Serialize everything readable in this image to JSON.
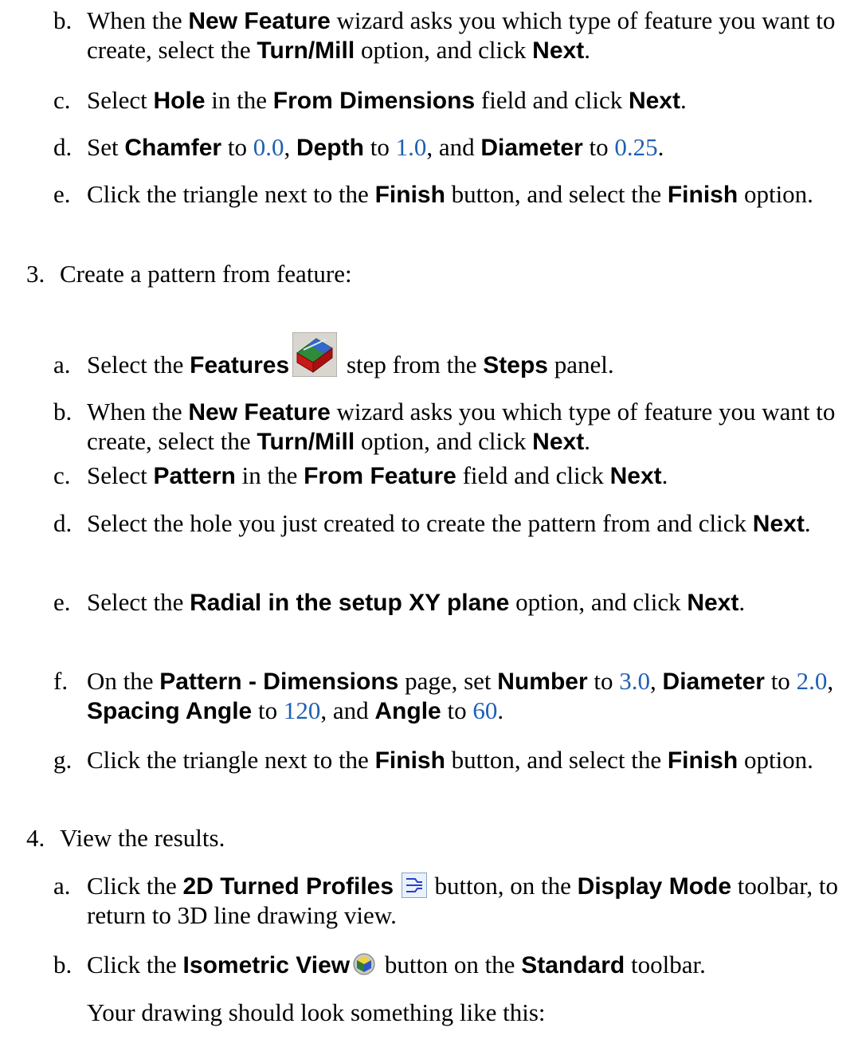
{
  "step2": {
    "b": {
      "letter": "b.",
      "t1": "When the ",
      "b1": "New Feature",
      "t2": " wizard asks you which type of feature you want to create, select the ",
      "b2": "Turn/Mill",
      "t3": " option, and click ",
      "b3": "Next",
      "t4": "."
    },
    "c": {
      "letter": "c.",
      "t1": "Select ",
      "b1": "Hole",
      "t2": " in the ",
      "b2": "From Dimensions",
      "t3": " field and click ",
      "b3": "Next",
      "t4": "."
    },
    "d": {
      "letter": "d.",
      "t1": "Set ",
      "b1": "Chamfer",
      "t2": " to ",
      "v1": "0.0",
      "t3": ", ",
      "b2": "Depth",
      "t4": " to ",
      "v2": "1.0",
      "t5": ", and ",
      "b3": "Diameter",
      "t6": " to ",
      "v3": "0.25",
      "t7": "."
    },
    "e": {
      "letter": "e.",
      "t1": "Click the triangle next to the ",
      "b1": "Finish",
      "t2": " button, and select the ",
      "b2": "Finish",
      "t3": " option."
    }
  },
  "step3": {
    "num": "3.",
    "title": "Create a pattern from feature:",
    "a": {
      "letter": "a.",
      "t1": "Select the ",
      "b1": "Features",
      "t2": " step from the ",
      "b2": "Steps",
      "t3": " panel.",
      "icon": "features-step-icon"
    },
    "b": {
      "letter": "b.",
      "t1": "When the ",
      "b1": "New Feature",
      "t2": " wizard asks you which type of feature you want to create, select the ",
      "b2": "Turn/Mill",
      "t3": " option, and click ",
      "b3": "Next",
      "t4": "."
    },
    "c": {
      "letter": "c.",
      "t1": "Select ",
      "b1": "Pattern",
      "t2": " in the ",
      "b2": "From Feature",
      "t3": " field and click ",
      "b3": "Next",
      "t4": "."
    },
    "d": {
      "letter": "d.",
      "t1": "Select the hole you just created to create the pattern from and click ",
      "b1": "Next",
      "t2": "."
    },
    "e": {
      "letter": "e.",
      "t1": "Select the ",
      "b1": "Radial in the setup XY plane",
      "t2": " option, and click ",
      "b2": "Next",
      "t3": "."
    },
    "f": {
      "letter": "f.",
      "t1": "On the ",
      "b1": "Pattern - Dimensions",
      "t2": " page, set ",
      "b2": "Number",
      "t3": " to ",
      "v1": "3.0",
      "t4": ", ",
      "b3": "Diameter",
      "t5": " to ",
      "v2": "2.0",
      "t6": ", ",
      "b4": "Spacing Angle",
      "t7": " to ",
      "v3": "120",
      "t8": ", and ",
      "b5": "Angle",
      "t9": " to ",
      "v4": "60",
      "t10": "."
    },
    "g": {
      "letter": "g.",
      "t1": "Click the triangle next to the ",
      "b1": "Finish",
      "t2": " button, and select the ",
      "b2": "Finish",
      "t3": " option."
    }
  },
  "step4": {
    "num": "4.",
    "title": "View the results.",
    "a": {
      "letter": "a.",
      "t1": "Click the ",
      "b1": "2D Turned Profiles",
      "t2": " button, on the ",
      "b2": "Display Mode",
      "t3": " toolbar, to return to 3D line drawing view.",
      "icon": "turned-profiles-icon"
    },
    "b": {
      "letter": "b.",
      "t1": "Click the ",
      "b1": "Isometric View",
      "t2": " button on the ",
      "b2": "Standard",
      "t3": " toolbar.",
      "icon": "isometric-view-icon"
    },
    "closing": "Your drawing should look something like this:"
  },
  "colors": {
    "value_blue": "#1f5fb4",
    "text": "#000000"
  }
}
